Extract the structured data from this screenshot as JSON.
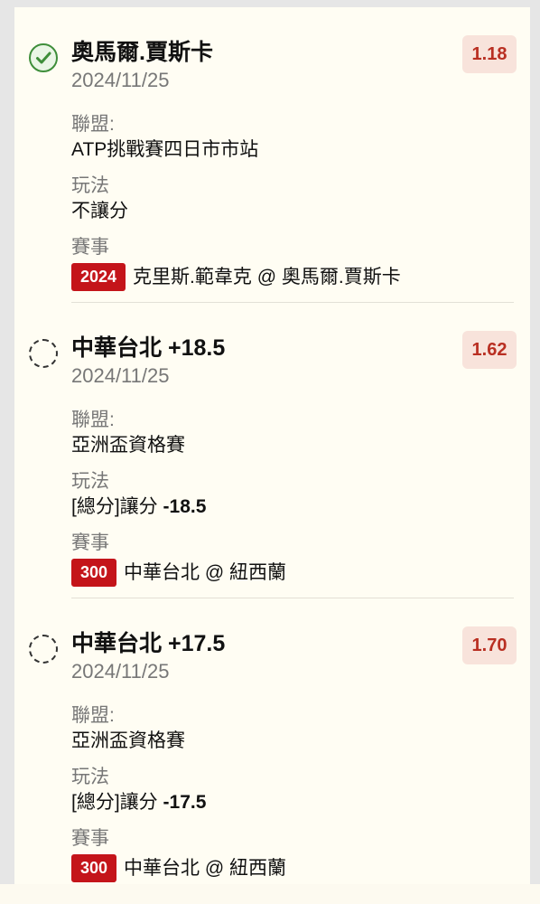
{
  "labels": {
    "league": "聯盟:",
    "play": "玩法",
    "event": "賽事"
  },
  "bets": [
    {
      "status": "selected",
      "status_icon": "check-circle-icon",
      "selection": "奧馬爾.賈斯卡",
      "line": "",
      "date": "2024/11/25",
      "odds": "1.18",
      "league": "ATP挑戰賽四日市市站",
      "play_prefix": "不讓分",
      "play_value": "",
      "event_tag": "2024",
      "event_matchup": "克里斯.範韋克 @ 奧馬爾.賈斯卡"
    },
    {
      "status": "unselected",
      "status_icon": "dashed-circle-icon",
      "selection": "中華台北",
      "line": "+18.5",
      "date": "2024/11/25",
      "odds": "1.62",
      "league": "亞洲盃資格賽",
      "play_prefix": "[總分]讓分",
      "play_value": "-18.5",
      "event_tag": "300",
      "event_matchup": "中華台北 @ 紐西蘭"
    },
    {
      "status": "unselected",
      "status_icon": "dashed-circle-icon",
      "selection": "中華台北",
      "line": "+17.5",
      "date": "2024/11/25",
      "odds": "1.70",
      "league": "亞洲盃資格賽",
      "play_prefix": "[總分]讓分",
      "play_value": "-17.5",
      "event_tag": "300",
      "event_matchup": "中華台北 @ 紐西蘭"
    }
  ],
  "colors": {
    "accent_red": "#c4141a",
    "odds_text": "#b92f22",
    "odds_background": "#f8e3db",
    "check_green": "#3e8e3a",
    "panel_background": "#fffdf3"
  }
}
